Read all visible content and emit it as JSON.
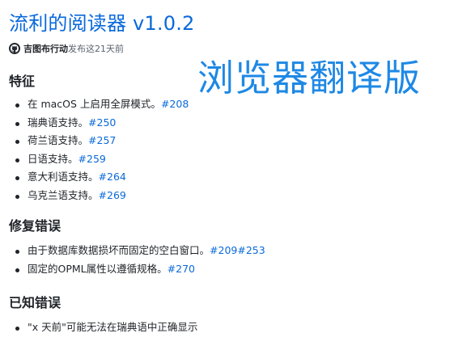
{
  "release": {
    "title": "流利的阅读器 v1.0.2",
    "author": "吉图布行动",
    "published_text": "发布这21天前"
  },
  "overlay_label": "浏览器翻译版",
  "colors": {
    "link": "#0969da",
    "overlay": "#1e88e5",
    "text": "#1f2328",
    "muted": "#59636e"
  },
  "sections": [
    {
      "heading": "特征",
      "items": [
        {
          "text": "在 macOS 上启用全屏模式。",
          "links": [
            "#208"
          ]
        },
        {
          "text": "瑞典语支持。",
          "links": [
            "#250"
          ]
        },
        {
          "text": "荷兰语支持。",
          "links": [
            "#257"
          ]
        },
        {
          "text": "日语支持。",
          "links": [
            "#259"
          ]
        },
        {
          "text": "意大利语支持。",
          "links": [
            "#264"
          ]
        },
        {
          "text": "乌克兰语支持。",
          "links": [
            "#269"
          ]
        }
      ]
    },
    {
      "heading": "修复错误",
      "items": [
        {
          "text": "由于数据库数据损坏而固定的空白窗口。",
          "links": [
            "#209",
            "#253"
          ]
        },
        {
          "text": "固定的OPML属性以遵循规格。",
          "links": [
            "#270"
          ]
        }
      ]
    },
    {
      "heading": "已知错误",
      "items": [
        {
          "text": "\"x 天前\"可能无法在瑞典语中正确显示",
          "links": []
        }
      ]
    }
  ],
  "icons": {
    "author_avatar": "github-octocat-icon"
  }
}
